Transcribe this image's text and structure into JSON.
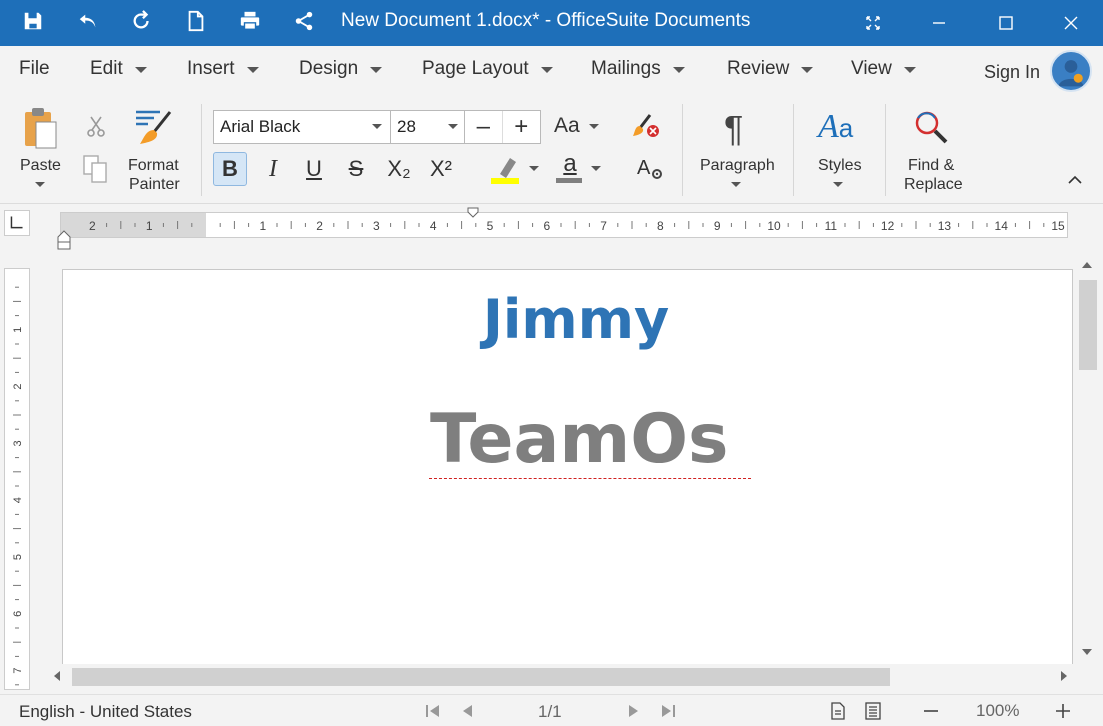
{
  "window": {
    "title": "New Document 1.docx* - OfficeSuite Documents"
  },
  "menu": {
    "items": [
      {
        "label": "File",
        "dropdown": false
      },
      {
        "label": "Edit",
        "dropdown": true
      },
      {
        "label": "Insert",
        "dropdown": true
      },
      {
        "label": "Design",
        "dropdown": true
      },
      {
        "label": "Page Layout",
        "dropdown": true
      },
      {
        "label": "Mailings",
        "dropdown": true
      },
      {
        "label": "Review",
        "dropdown": true
      },
      {
        "label": "View",
        "dropdown": true
      }
    ],
    "sign_in": "Sign In"
  },
  "ribbon": {
    "paste": "Paste",
    "format_painter_line1": "Format",
    "format_painter_line2": "Painter",
    "font_name": "Arial Black",
    "font_size": "28",
    "minus": "–",
    "plus": "+",
    "change_case": "Aa",
    "bold": "B",
    "italic": "I",
    "underline": "U",
    "strike": "S",
    "subscript": "X₂",
    "superscript": "X²",
    "paragraph": "Paragraph",
    "styles": "Styles",
    "find_line1": "Find &",
    "find_line2": "Replace"
  },
  "ruler": {
    "left_labels": [
      "2",
      "1"
    ],
    "labels": [
      "1",
      "2",
      "3",
      "4",
      "5",
      "6",
      "7",
      "8",
      "9",
      "10",
      "11",
      "12",
      "13",
      "14",
      "15"
    ],
    "vlabels": [
      "1",
      "2",
      "3",
      "4",
      "5",
      "6",
      "7"
    ]
  },
  "document": {
    "line1": "Jimmy",
    "line2": "TeamOs",
    "line1_color": "#2e74b5",
    "line2_color": "#7f7f7f"
  },
  "status": {
    "language": "English - United States",
    "page": "1/1",
    "zoom": "100%"
  },
  "colors": {
    "title_bar": "#1e6fb9",
    "highlight": "#ffff00",
    "font_color_bar": "#7f7f7f"
  }
}
